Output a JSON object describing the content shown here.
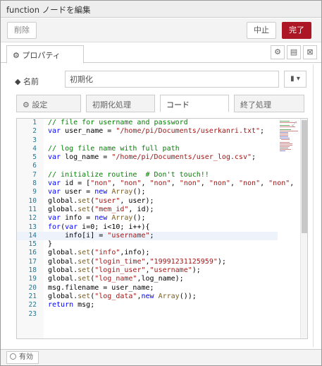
{
  "dialog": {
    "title": "function ノードを編集"
  },
  "toolbar": {
    "delete_label": "削除",
    "cancel_label": "中止",
    "done_label": "完了"
  },
  "panel_tabs": {
    "properties_label": "⚙ プロパティ"
  },
  "form": {
    "name_label": "名前",
    "name_icon": "tag-icon",
    "name_value": "初期化"
  },
  "inner_tabs": [
    {
      "label": "⚙ 設定"
    },
    {
      "label": "初期化処理"
    },
    {
      "label": "コード"
    },
    {
      "label": "終了処理"
    }
  ],
  "editor": {
    "lines": [
      {
        "n": "1",
        "t": "// file for username and password"
      },
      {
        "n": "2",
        "t": "var user_name = \"/home/pi/Documents/userkanri.txt\";"
      },
      {
        "n": "3",
        "t": ""
      },
      {
        "n": "4",
        "t": "// log file name with full path"
      },
      {
        "n": "5",
        "t": "var log_name = \"/home/pi/Documents/user_log.csv\";"
      },
      {
        "n": "6",
        "t": ""
      },
      {
        "n": "7",
        "t": "// initialize routine  # Don't touch!!"
      },
      {
        "n": "8",
        "t": "var id = [\"non\", \"non\", \"non\", \"non\", \"non\", \"non\", \"non\","
      },
      {
        "n": "9",
        "t": "var user = new Array();"
      },
      {
        "n": "10",
        "t": "global.set(\"user\", user);"
      },
      {
        "n": "11",
        "t": "global.set(\"mem_id\", id);"
      },
      {
        "n": "12",
        "t": "var info = new Array();"
      },
      {
        "n": "13",
        "t": "for(var i=0; i<10; i++){"
      },
      {
        "n": "14",
        "t": "    info[i] = \"username\";"
      },
      {
        "n": "15",
        "t": "}"
      },
      {
        "n": "16",
        "t": "global.set(\"info\",info);"
      },
      {
        "n": "17",
        "t": "global.set(\"login_time\",\"19991231125959\");"
      },
      {
        "n": "18",
        "t": "global.set(\"login_user\",\"username\");"
      },
      {
        "n": "19",
        "t": "global.set(\"log_name\",log_name);"
      },
      {
        "n": "20",
        "t": "msg.filename = user_name;"
      },
      {
        "n": "21",
        "t": "global.set(\"log_data\",new Array());"
      },
      {
        "n": "22",
        "t": "return msg;"
      },
      {
        "n": "23",
        "t": ""
      }
    ]
  },
  "footer": {
    "enable_label": "有効"
  },
  "colors": {
    "accent": "#ad1625"
  }
}
